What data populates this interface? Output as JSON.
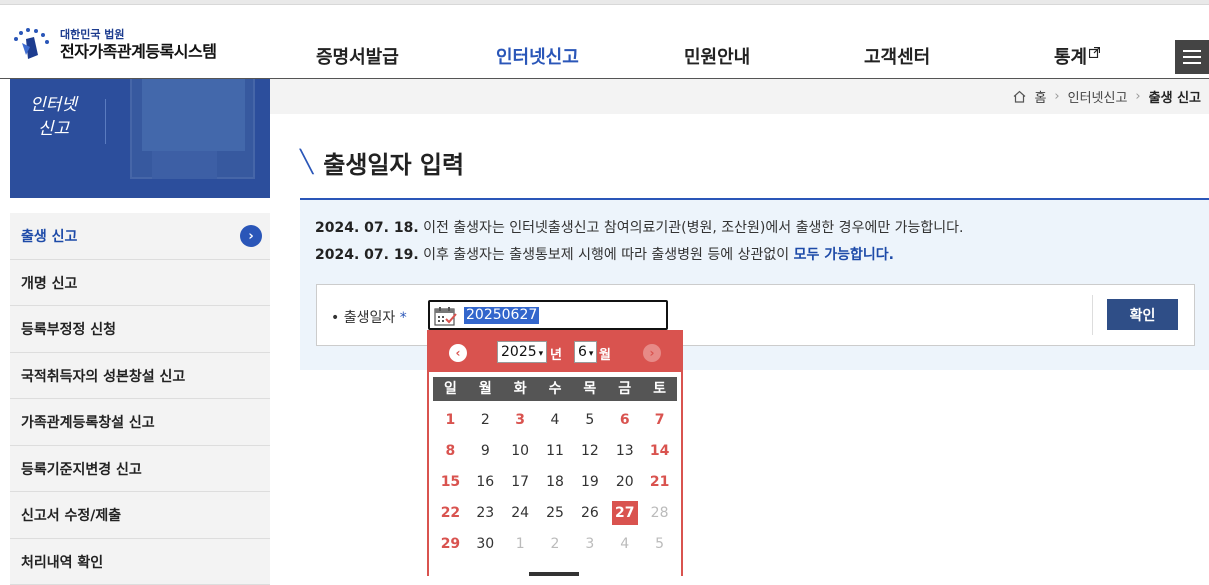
{
  "header": {
    "logo_sub": "대한민국 법원",
    "logo_main": "전자가족관계등록시스템",
    "nav": [
      {
        "label": "증명서발급",
        "active": false
      },
      {
        "label": "인터넷신고",
        "active": true
      },
      {
        "label": "민원안내",
        "active": false
      },
      {
        "label": "고객센터",
        "active": false
      },
      {
        "label": "통계",
        "active": false
      }
    ],
    "external_icon": "external-link-icon",
    "menu_icon": "hamburger-menu-icon"
  },
  "banner": {
    "title_line1": "인터넷",
    "title_line2": "신고"
  },
  "sidebar": {
    "items": [
      {
        "label": "출생 신고",
        "active": true
      },
      {
        "label": "개명 신고",
        "active": false
      },
      {
        "label": "등록부정정 신청",
        "active": false
      },
      {
        "label": "국적취득자의 성본창설 신고",
        "active": false
      },
      {
        "label": "가족관계등록창설 신고",
        "active": false
      },
      {
        "label": "등록기준지변경 신고",
        "active": false
      },
      {
        "label": "신고서 수정/제출",
        "active": false
      },
      {
        "label": "처리내역 확인",
        "active": false
      }
    ]
  },
  "breadcrumb": {
    "home": "홈",
    "level1": "인터넷신고",
    "current": "출생 신고"
  },
  "page": {
    "title": "출생일자 입력"
  },
  "notice": {
    "line1_date": "2024. 07. 18.",
    "line1_text": " 이전 출생자는 인터넷출생신고 참여의료기관(병원, 조산원)에서 출생한 경우에만 가능합니다.",
    "line2_date": "2024. 07. 19.",
    "line2_text": " 이후 출생자는 출생통보제 시행에 따라 출생병원 등에 상관없이 ",
    "line2_emph": "모두 가능합니다."
  },
  "form": {
    "label": "출생일자",
    "required_mark": "*",
    "bullet": "•",
    "date_value": "20250627",
    "confirm_label": "확인"
  },
  "datepicker": {
    "year": "2025",
    "month": "6",
    "year_unit": "년",
    "month_unit": "월",
    "weekdays": [
      "일",
      "월",
      "화",
      "수",
      "목",
      "금",
      "토"
    ],
    "weeks": [
      [
        "1",
        "2",
        "3",
        "4",
        "5",
        "6",
        "7"
      ],
      [
        "8",
        "9",
        "10",
        "11",
        "12",
        "13",
        "14"
      ],
      [
        "15",
        "16",
        "17",
        "18",
        "19",
        "20",
        "21"
      ],
      [
        "22",
        "23",
        "24",
        "25",
        "26",
        "27",
        "28"
      ],
      [
        "29",
        "30",
        "1",
        "2",
        "3",
        "4",
        "5"
      ]
    ],
    "selected_day": "27",
    "holidays": [
      "3",
      "6"
    ],
    "colors": {
      "accent": "#d9534f",
      "header_row": "#555555"
    }
  },
  "colors": {
    "primary": "#2a56b8",
    "banner": "#2c4e9c",
    "button": "#2f4e87"
  }
}
